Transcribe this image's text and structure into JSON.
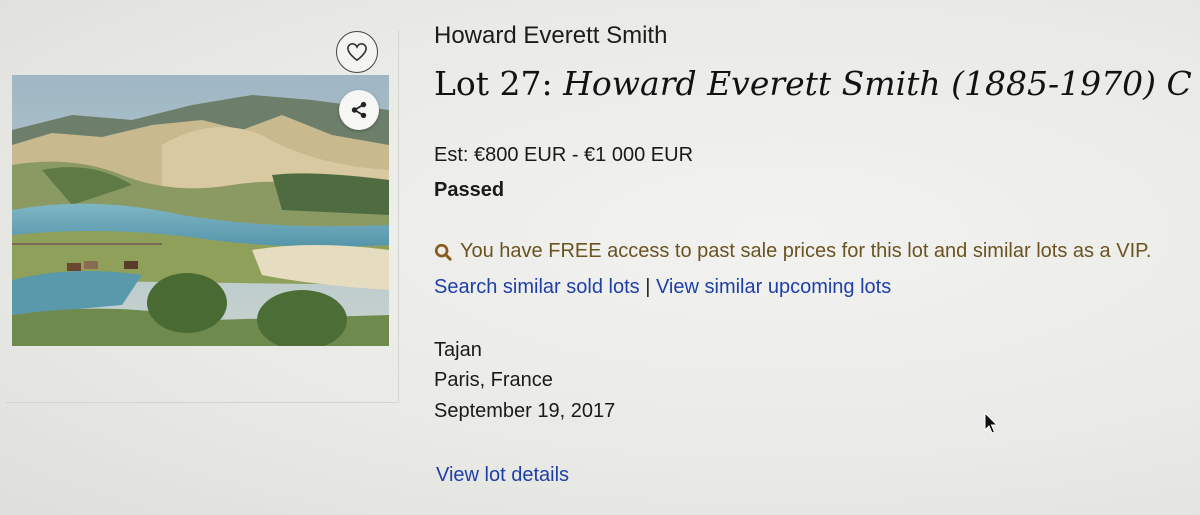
{
  "artist": {
    "name": "Howard Everett Smith"
  },
  "lot": {
    "prefix": "Lot 27: ",
    "title": "Howard Everett Smith (1885-1970) C"
  },
  "estimate": "Est: €800 EUR - €1 000 EUR",
  "status": "Passed",
  "vip_notice": "You have FREE access to past sale prices for this lot and similar lots as a VIP.",
  "links": {
    "similar_sold": "Search similar sold lots",
    "separator": "|",
    "similar_upcoming": "View similar upcoming lots"
  },
  "sale": {
    "auction_house": "Tajan",
    "location": "Paris, France",
    "date": "September 19, 2017"
  },
  "details_link": "View lot details",
  "icons": {
    "favorite": "heart-icon",
    "share": "share-icon",
    "vip": "vip-search-icon"
  },
  "colors": {
    "link": "#1f3fa8",
    "vip_text": "#6b5321",
    "background": "#ececea"
  }
}
